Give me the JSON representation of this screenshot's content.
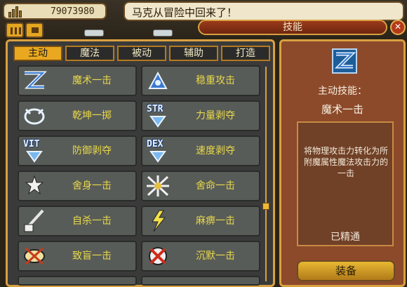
{
  "hud": {
    "gold": "79073980",
    "message": "马克从冒险中回来了！"
  },
  "window": {
    "title": "技能",
    "close_icon": "close-icon"
  },
  "tabs": [
    {
      "label": "主动",
      "active": true
    },
    {
      "label": "魔法",
      "active": false
    },
    {
      "label": "被动",
      "active": false
    },
    {
      "label": "辅助",
      "active": false
    },
    {
      "label": "打造",
      "active": false
    }
  ],
  "skills": [
    {
      "name": "魔术一击",
      "icon": "magic-bolt-icon"
    },
    {
      "name": "稳重攻击",
      "icon": "heavy-strike-icon"
    },
    {
      "name": "乾坤一掷",
      "icon": "throw-icon"
    },
    {
      "name": "力量剥夺",
      "icon": "str-down-icon",
      "icon_text": "STR"
    },
    {
      "name": "防御剥夺",
      "icon": "vit-down-icon",
      "icon_text": "VIT"
    },
    {
      "name": "速度剥夺",
      "icon": "dex-down-icon",
      "icon_text": "DEX"
    },
    {
      "name": "舍身一击",
      "icon": "sacrifice-icon"
    },
    {
      "name": "舍命一击",
      "icon": "desperate-strike-icon"
    },
    {
      "name": "自杀一击",
      "icon": "suicide-strike-icon"
    },
    {
      "name": "麻痹一击",
      "icon": "paralyze-icon"
    },
    {
      "name": "致盲一击",
      "icon": "blind-icon"
    },
    {
      "name": "沉默一击",
      "icon": "silence-icon"
    }
  ],
  "detail": {
    "type_label": "主动技能：",
    "name": "魔术一击",
    "description": "将物理攻击力转化为所附魔属性魔法攻击力的一击",
    "status": "已精通",
    "equip_label": "装备"
  }
}
